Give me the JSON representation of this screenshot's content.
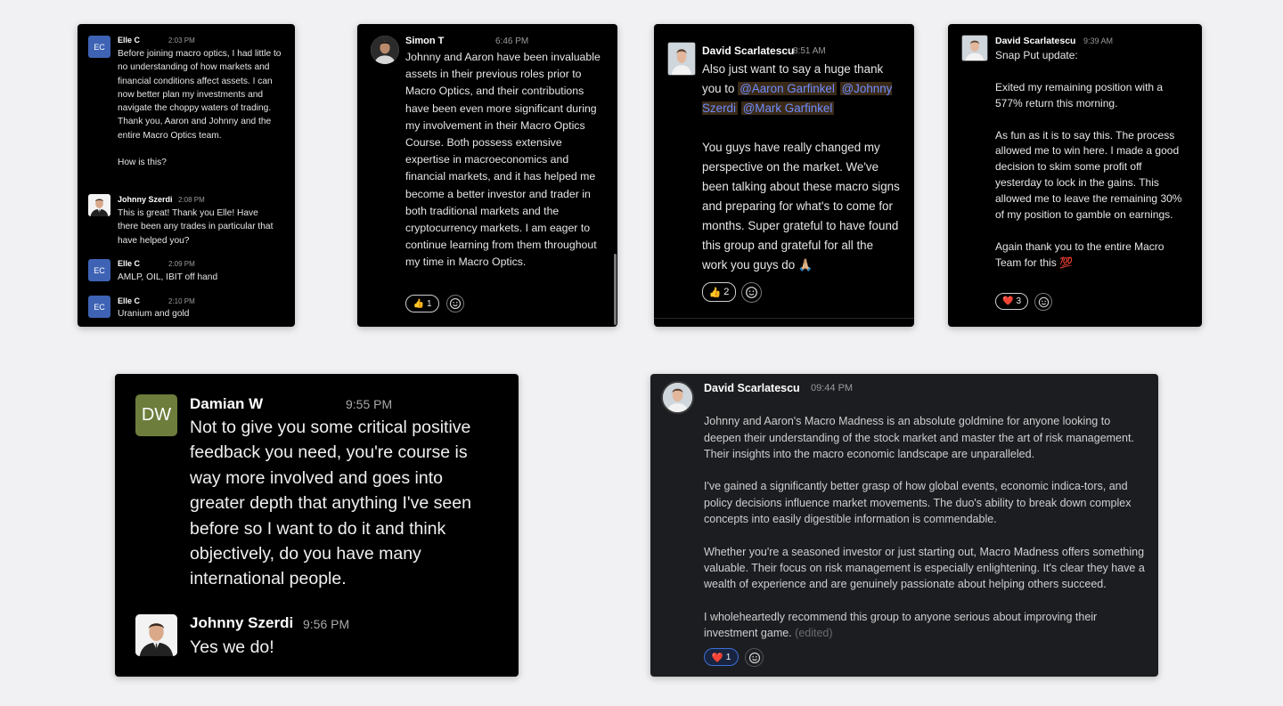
{
  "colors": {
    "background": "#f1f1f3",
    "card_black": "#000000",
    "card_dark": "#1c1d21",
    "mention_text": "#6f8cff",
    "mention_bg": "#3a2a17",
    "ec_avatar": "#3f63b4",
    "dw_avatar": "#6c7d3c"
  },
  "card1": {
    "messages": [
      {
        "avatar": "EC",
        "name": "Elle C",
        "time": "2:03 PM",
        "text": "Before joining macro optics, I had little to no understanding of how markets and financial conditions affect assets. I can now better plan my investments and navigate the choppy waters of trading.  Thank you, Aaron and Johnny and the entire Macro Optics team.\n\nHow is this?"
      },
      {
        "name": "Johnny Szerdi",
        "time": "2:08 PM",
        "text": "This is great! Thank you Elle! Have there been any trades in particular that have helped you?"
      },
      {
        "avatar": "EC",
        "name": "Elle C",
        "time": "2:09 PM",
        "text": "AMLP, OIL, IBIT off hand"
      },
      {
        "avatar": "EC",
        "name": "Elle C",
        "time": "2:10 PM",
        "text": "Uranium and gold"
      }
    ]
  },
  "card2": {
    "name": "Simon T",
    "time": "6:46 PM",
    "text": "Johnny and Aaron have been invaluable assets in their previous roles prior to Macro Optics, and their contributions have been even more significant during my involvement in their Macro Optics Course. Both possess extensive expertise in macroeconomics and financial markets, and it has helped me become a better investor and trader in both traditional markets and the cryptocurrency markets. I am eager to continue learning from them throughout my time in Macro Optics.",
    "reaction": {
      "emoji": "👍",
      "count": "1",
      "icon": "thumbs-up-icon"
    }
  },
  "card3": {
    "name": "David Scarlatescu",
    "time": "8:51 AM",
    "text_before": "Also just want to say a huge thank you to ",
    "mentions": [
      "@Aaron Garfinkel",
      "@Johnny Szerdi",
      "@Mark Garfinkel"
    ],
    "text_after": "You guys have really changed my perspective on the market. We've been talking about these macro signs and preparing for what's to come for months. Super grateful to have found this group and grateful for all the work you guys do 🙏🏼",
    "reaction": {
      "emoji": "👍",
      "count": "2",
      "icon": "thumbs-up-icon"
    }
  },
  "card4": {
    "name": "David Scarlatescu",
    "time": "9:39 AM",
    "text": "Snap Put update:\n\nExited my remaining position with a 577% return this morning.\n\nAs fun as it is to say this. The process allowed me to win here. I made a good decision to skim some profit off yesterday to lock in the gains. This allowed me to leave the remaining 30% of my position to gamble on earnings.\n\nAgain thank you to the entire Macro Team for this 💯",
    "reaction": {
      "emoji": "❤️",
      "count": "3",
      "icon": "heart-icon"
    }
  },
  "card5": {
    "messages": [
      {
        "avatar": "DW",
        "name": "Damian W",
        "time": "9:55 PM",
        "text": "Not to give you some critical positive feedback you need, you're course is way more involved and goes into greater depth that anything I've seen before so I want to do it and think objectively, do you have many international people."
      },
      {
        "name": "Johnny Szerdi",
        "time": "9:56 PM",
        "text": "Yes we do!"
      }
    ]
  },
  "card6": {
    "name": "David Scarlatescu",
    "time": "09:44 PM",
    "text": "Johnny and Aaron's Macro Madness is an absolute goldmine for anyone looking to deepen their understanding of the stock market and master the art of risk management. Their insights into the macro economic landscape are unparalleled.\n\nI've gained a significantly better grasp of how global events, economic indica-tors, and policy decisions influence market movements. The duo's ability to break down complex concepts into easily digestible information is commendable.\n\nWhether you're a seasoned investor or just starting out, Macro Madness offers something valuable. Their focus on risk management is especially enlightening. It's clear they have a wealth of experience and are genuinely passionate about helping others succeed.\n\nI wholeheartedly recommend this group to anyone serious about improving their investment game.",
    "edited": "(edited)",
    "reaction": {
      "emoji": "❤️",
      "count": "1",
      "icon": "heart-icon"
    }
  }
}
